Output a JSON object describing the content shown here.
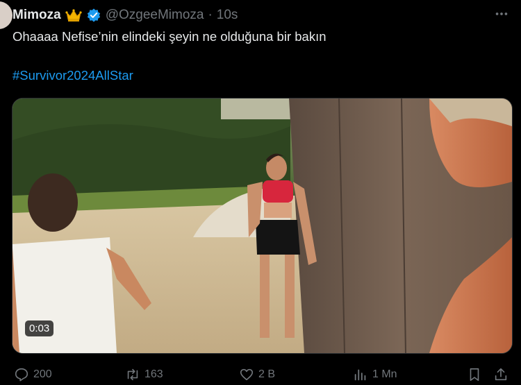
{
  "user": {
    "display_name": "Mimoza",
    "handle": "@OzgeeMimoza",
    "separator": "·",
    "time": "10s"
  },
  "tweet": {
    "text": "Ohaaaa Nefise’nin elindeki şeyin ne olduğuna bir bakın",
    "hashtag": "#Survivor2024AllStar"
  },
  "media": {
    "duration": "0:03"
  },
  "actions": {
    "replies": "200",
    "retweets": "163",
    "likes": "2 B",
    "views": "1 Mn"
  },
  "colors": {
    "background": "#000000",
    "text": "#e7e9ea",
    "muted": "#71767b",
    "link": "#1d9bf0",
    "verified": "#1d9bf0",
    "crown": "#f4b400"
  },
  "icons": [
    "crown-icon",
    "verified-badge-icon",
    "more-options-icon",
    "reply-icon",
    "retweet-icon",
    "like-icon",
    "views-icon",
    "bookmark-icon",
    "share-icon"
  ]
}
